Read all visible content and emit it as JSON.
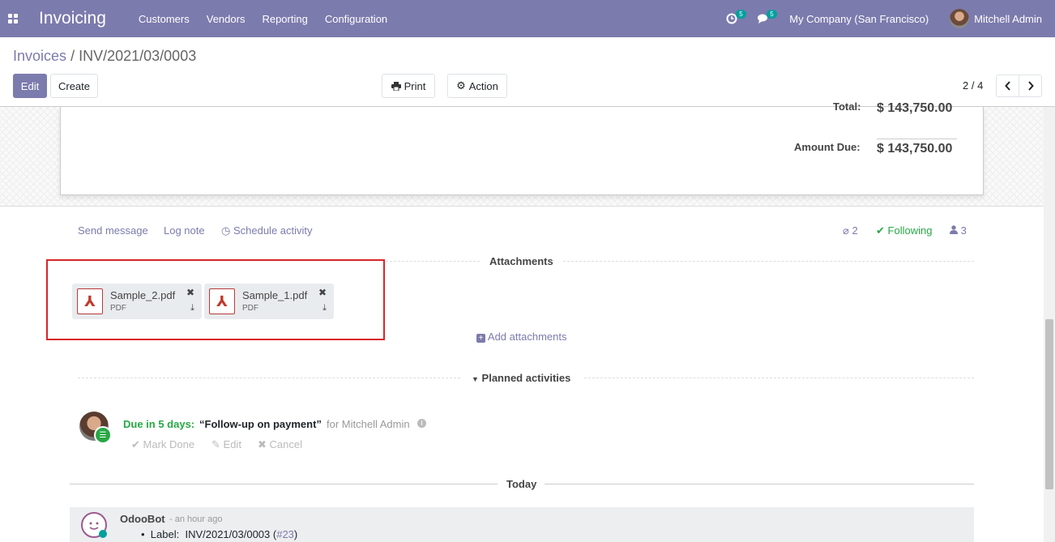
{
  "navbar": {
    "app_name": "Invoicing",
    "menu": [
      "Customers",
      "Vendors",
      "Reporting",
      "Configuration"
    ],
    "activity_count": "5",
    "message_count": "5",
    "company": "My Company (San Francisco)",
    "user": "Mitchell Admin",
    "accent": "#7c7bad"
  },
  "breadcrumb": {
    "parent": "Invoices",
    "separator": "/",
    "current": "INV/2021/03/0003"
  },
  "toolbar": {
    "edit": "Edit",
    "create": "Create",
    "print": "Print",
    "action": "Action",
    "pager": "2 / 4"
  },
  "totals": {
    "total_label": "Total:",
    "total_value": "$ 143,750.00",
    "due_label": "Amount Due:",
    "due_value": "$ 143,750.00"
  },
  "chatter": {
    "send_message": "Send message",
    "log_note": "Log note",
    "schedule_activity": "Schedule activity",
    "attachment_count": "2",
    "following": "Following",
    "follower_count": "3",
    "attachments_title": "Attachments",
    "attachments": [
      {
        "name": "Sample_2.pdf",
        "type": "PDF"
      },
      {
        "name": "Sample_1.pdf",
        "type": "PDF"
      }
    ],
    "add_attachments": "Add attachments",
    "planned_title": "Planned activities",
    "activity": {
      "due": "Due in 5 days:",
      "summary": "“Follow-up on payment”",
      "for": "for Mitchell Admin",
      "mark_done": "Mark Done",
      "edit": "Edit",
      "cancel": "Cancel"
    },
    "today_title": "Today",
    "message": {
      "author": "OdooBot",
      "time": "- an hour ago",
      "label_text": "Label:",
      "label_value": "INV/2021/03/0003",
      "ref": "#23"
    }
  }
}
